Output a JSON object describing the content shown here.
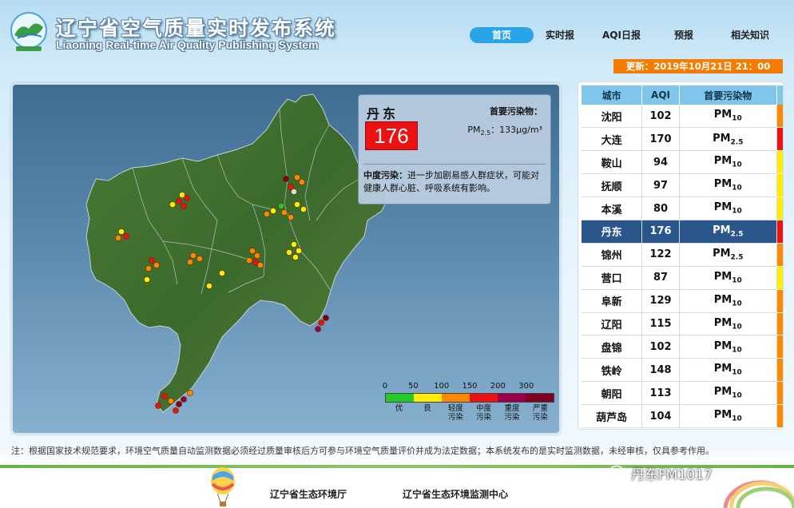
{
  "header": {
    "title_cn": "辽宁省空气质量实时发布系统",
    "title_en": "Liaoning Real-time Air Quality Publishing System",
    "nav": [
      {
        "label": "首页",
        "active": true
      },
      {
        "label": "实时报",
        "active": false
      },
      {
        "label": "AQI日报",
        "active": false
      },
      {
        "label": "预报",
        "active": false
      },
      {
        "label": "相关知识",
        "active": false
      }
    ],
    "update_label": "更新：",
    "update_time": "2019年10月21日  21：00",
    "update_color": "#f57c00"
  },
  "info_box": {
    "city": "丹东",
    "aqi": "176",
    "aqi_color": "#ee1111",
    "primary_pollutant_label": "首要污染物：",
    "primary_pollutant_name": "PM",
    "primary_pollutant_sub": "2.5",
    "primary_pollutant_value": "：133μg/m³",
    "level": "中度污染：",
    "description": "进一步加剧易感人群症状，可能对健康人群心脏、呼吸系统有影响。"
  },
  "legend": {
    "ticks": [
      "0",
      "50",
      "100",
      "150",
      "200",
      "300"
    ],
    "segments": [
      {
        "color": "#22cc22",
        "label": "优"
      },
      {
        "color": "#ffee00",
        "label": "良"
      },
      {
        "color": "#ff8800",
        "label": "轻度\n污染"
      },
      {
        "color": "#ee1111",
        "label": "中度\n污染"
      },
      {
        "color": "#99004c",
        "label": "重度\n污染"
      },
      {
        "color": "#7e0023",
        "label": "严重\n污染"
      }
    ]
  },
  "table": {
    "headers": {
      "city": "城市",
      "aqi": "AQI",
      "pollutant": "首要污染物"
    },
    "rows": [
      {
        "city": "沈阳",
        "aqi": "102",
        "pm": "PM",
        "sub": "10",
        "color": "#ff8800",
        "selected": false
      },
      {
        "city": "大连",
        "aqi": "170",
        "pm": "PM",
        "sub": "2.5",
        "color": "#ee1111",
        "selected": false
      },
      {
        "city": "鞍山",
        "aqi": "94",
        "pm": "PM",
        "sub": "10",
        "color": "#ffee00",
        "selected": false
      },
      {
        "city": "抚顺",
        "aqi": "97",
        "pm": "PM",
        "sub": "10",
        "color": "#ffee00",
        "selected": false
      },
      {
        "city": "本溪",
        "aqi": "80",
        "pm": "PM",
        "sub": "10",
        "color": "#ffee00",
        "selected": false
      },
      {
        "city": "丹东",
        "aqi": "176",
        "pm": "PM",
        "sub": "2.5",
        "color": "#ee1111",
        "selected": true
      },
      {
        "city": "锦州",
        "aqi": "122",
        "pm": "PM",
        "sub": "2.5",
        "color": "#ff8800",
        "selected": false
      },
      {
        "city": "营口",
        "aqi": "87",
        "pm": "PM",
        "sub": "10",
        "color": "#ffee00",
        "selected": false
      },
      {
        "city": "阜新",
        "aqi": "129",
        "pm": "PM",
        "sub": "10",
        "color": "#ff8800",
        "selected": false
      },
      {
        "city": "辽阳",
        "aqi": "115",
        "pm": "PM",
        "sub": "10",
        "color": "#ff8800",
        "selected": false
      },
      {
        "city": "盘锦",
        "aqi": "102",
        "pm": "PM",
        "sub": "10",
        "color": "#ff8800",
        "selected": false
      },
      {
        "city": "铁岭",
        "aqi": "148",
        "pm": "PM",
        "sub": "10",
        "color": "#ff8800",
        "selected": false
      },
      {
        "city": "朝阳",
        "aqi": "113",
        "pm": "PM",
        "sub": "10",
        "color": "#ff8800",
        "selected": false
      },
      {
        "city": "葫芦岛",
        "aqi": "104",
        "pm": "PM",
        "sub": "10",
        "color": "#ff8800",
        "selected": false
      }
    ]
  },
  "note": "注：根据国家技术规范要求，环境空气质量自动监测数据必须经过质量审核后方可参与环境空气质量评价并成为法定数据；本系统发布的是实时监测数据，未经审核，仅具参考作用。",
  "footer": {
    "link1": "辽宁省生态环境厅",
    "link2": "辽宁省生态环境监测中心",
    "watermark": "丹东FM1017"
  }
}
